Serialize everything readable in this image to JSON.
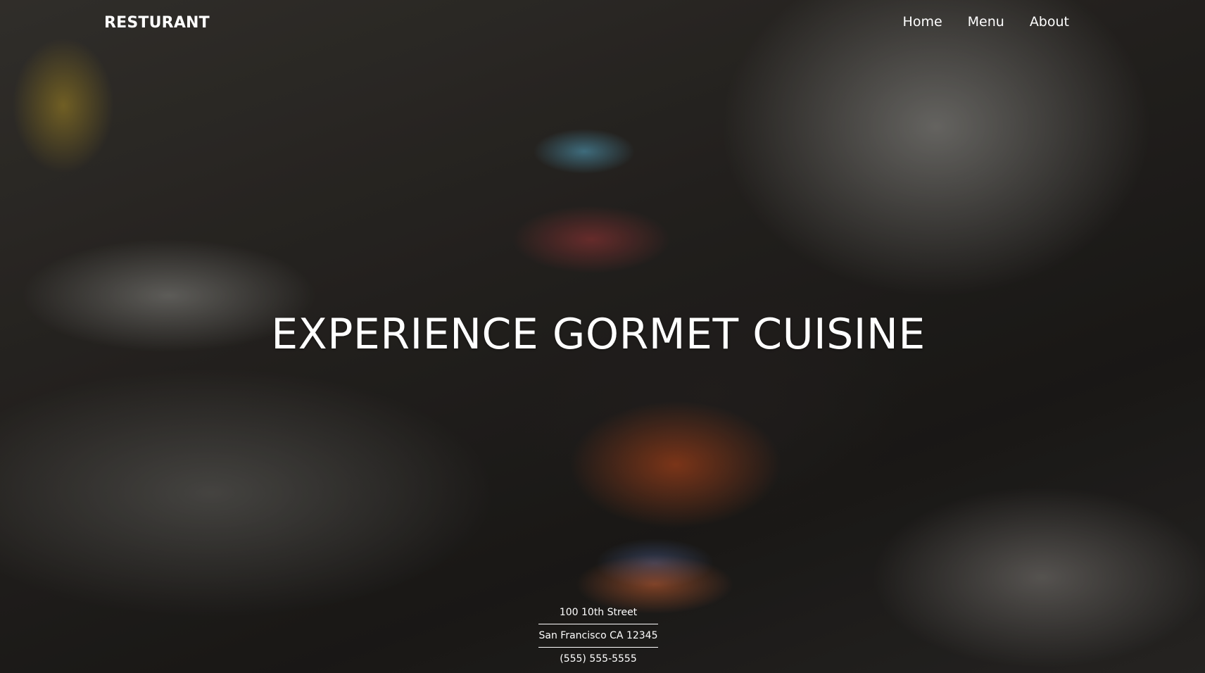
{
  "brand": {
    "name": "RESTURANT"
  },
  "nav": {
    "items": [
      {
        "label": "Home"
      },
      {
        "label": "Menu"
      },
      {
        "label": "About"
      }
    ]
  },
  "hero": {
    "headline": "EXPERIENCE GORMET CUISINE"
  },
  "footer": {
    "street": "100 10th Street",
    "city": "San Francisco CA 12345",
    "phone": "(555) 555-5555"
  }
}
